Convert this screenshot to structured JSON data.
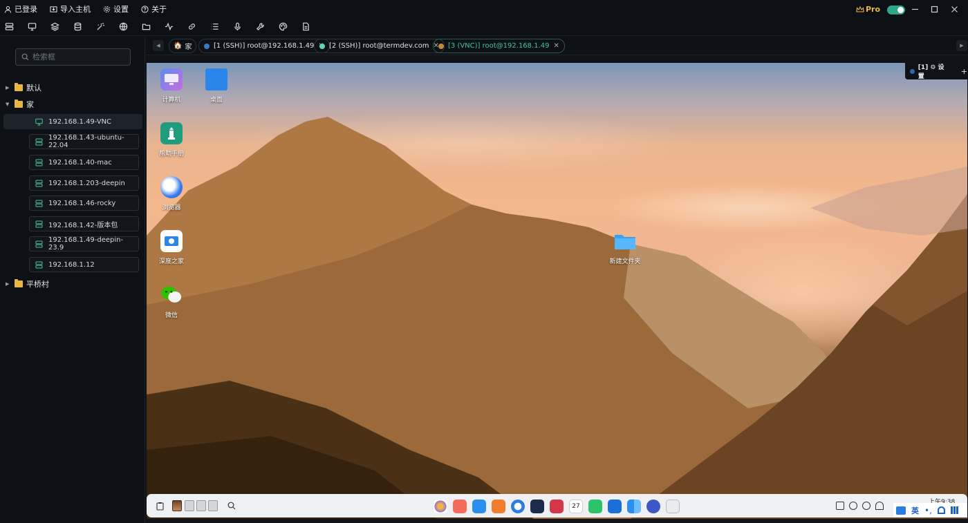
{
  "titlebar": {
    "menu": [
      {
        "label": "已登录",
        "icon": "user-icon"
      },
      {
        "label": "导入主机",
        "icon": "import-icon"
      },
      {
        "label": "设置",
        "icon": "gear-icon"
      },
      {
        "label": "关于",
        "icon": "help-icon"
      }
    ],
    "pro_label": "Pro",
    "toggle_on": true,
    "accent": "#2fa58a"
  },
  "toolbar": {
    "icons": [
      "server-list-icon",
      "monitor-icon",
      "layers-icon",
      "database-icon",
      "magic-wand-icon",
      "globe-icon",
      "folder-icon",
      "activity-icon",
      "link-icon",
      "list-icon",
      "microphone-icon",
      "wrench-icon",
      "palette-icon",
      "document-icon"
    ]
  },
  "sidebar": {
    "search_placeholder": "检索框",
    "folders": [
      {
        "label": "默认",
        "expanded": false
      },
      {
        "label": "家",
        "expanded": true
      },
      {
        "label": "平桥村",
        "expanded": false
      }
    ],
    "hosts": [
      {
        "label": "192.168.1.49-VNC",
        "type": "vnc",
        "selected": true
      },
      {
        "label": "192.168.1.43-ubuntu-22.04",
        "type": "ssh"
      },
      {
        "label": "192.168.1.40-mac",
        "type": "ssh"
      },
      {
        "label": "192.168.1.203-deepin",
        "type": "ssh"
      },
      {
        "label": "192.168.1.46-rocky",
        "type": "ssh"
      },
      {
        "label": "192.168.1.42-版本包",
        "type": "ssh"
      },
      {
        "label": "192.168.1.49-deepin-23.9",
        "type": "ssh"
      },
      {
        "label": "192.168.1.12",
        "type": "ssh"
      }
    ],
    "host_icon_color": "#41c79c"
  },
  "tabs": {
    "home_label": "家",
    "items": [
      {
        "label": "[1 (SSH)] root@192.168.1.49",
        "dot": "#3a78c9",
        "active": false
      },
      {
        "label": "[2 (SSH)] root@termdev.com",
        "dot": "#5fd7b0",
        "active": false
      },
      {
        "label": "[3 (VNC)] root@192.168.1.49",
        "dot": "#c08a3a",
        "active": true
      }
    ]
  },
  "remote": {
    "overlay": {
      "label": "[1] ⚙ 设置",
      "plus": "+"
    },
    "desktop_icons": [
      {
        "label": "计算机",
        "icon": "computer-icon"
      },
      {
        "label": "桌面",
        "icon": "desktop-folder-icon"
      },
      {
        "label": "帮助手册",
        "icon": "help-manual-icon"
      },
      {
        "label": "浏览器",
        "icon": "browser-icon"
      },
      {
        "label": "深度之家",
        "icon": "deepin-home-icon"
      },
      {
        "label": "微信",
        "icon": "wechat-icon"
      },
      {
        "label": "新建文件夹",
        "icon": "folder-icon"
      }
    ],
    "taskbar": {
      "clock": "上午9:38",
      "ime": "英",
      "apps": [
        {
          "name": "launcher-icon",
          "color": "#8f6ee0"
        },
        {
          "name": "multitask-icon",
          "color": "#f26b5b"
        },
        {
          "name": "file-manager-icon",
          "color": "#2b8ff0"
        },
        {
          "name": "app-store-icon",
          "color": "#f07d2c"
        },
        {
          "name": "browser-icon",
          "color": "#2a7de1"
        },
        {
          "name": "text-editor-icon",
          "color": "#1c2b4a"
        },
        {
          "name": "terminal-icon",
          "color": "#d4374a"
        },
        {
          "name": "calendar-icon",
          "color": "#ffffff"
        },
        {
          "name": "music-icon",
          "color": "#2cc36b"
        },
        {
          "name": "board-icon",
          "color": "#1c6fd6"
        },
        {
          "name": "widgets-icon",
          "color": "#2b8ff0"
        },
        {
          "name": "control-center-icon",
          "color": "#3d56c8"
        },
        {
          "name": "recycle-icon",
          "color": "#7cb342"
        }
      ]
    }
  }
}
